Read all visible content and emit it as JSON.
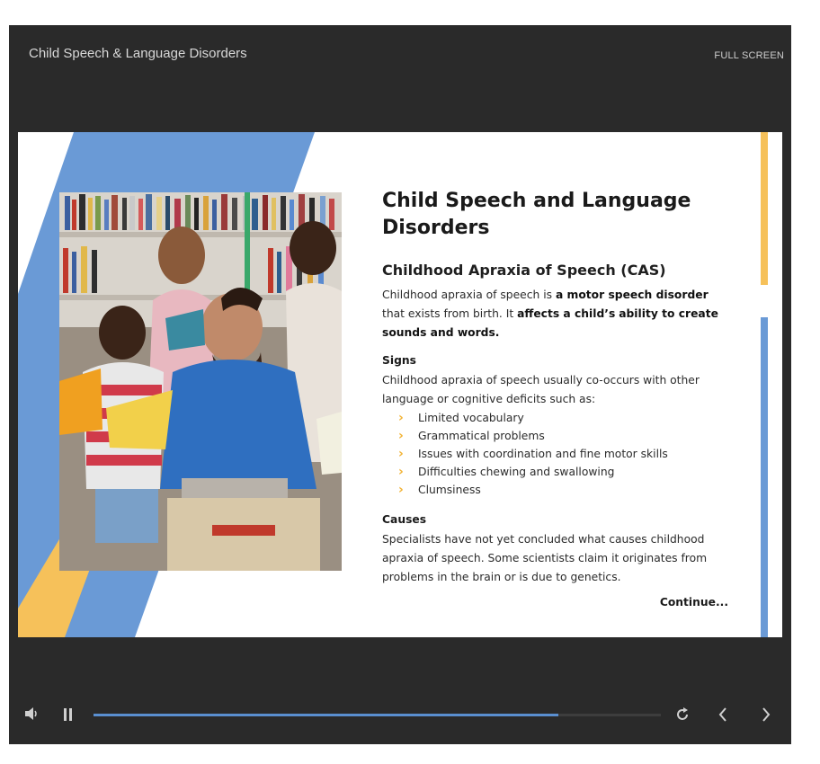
{
  "player": {
    "title": "Child Speech & Language Disorders",
    "fullscreen_label": "FULL SCREEN"
  },
  "slide": {
    "heading": "Child Speech and Language Disorders",
    "subheading": "Childhood Apraxia of Speech (CAS)",
    "intro": {
      "t1": "Childhood apraxia of speech is ",
      "b1": "a motor speech disorder",
      "t2": " that exists from birth. It ",
      "b2": "affects a child’s",
      "t3": " ",
      "b3": "ability to create sounds and words."
    },
    "signs_heading": "Signs",
    "signs_text": "Childhood apraxia of speech usually co-occurs with other language or cognitive deficits such as:",
    "signs": [
      "Limited vocabulary",
      "Grammatical problems",
      "Issues with coordination and fine motor skills",
      "Difficulties chewing and swallowing",
      "Clumsiness"
    ],
    "causes_heading": "Causes",
    "causes_text": "Specialists have not yet concluded what causes childhood apraxia of speech. Some scientists claim it originates from problems in the brain or is due to genetics.",
    "continue_label": "Continue..."
  },
  "playback": {
    "progress_fraction": 0.82,
    "icons": [
      "volume-icon",
      "pause-icon",
      "replay-icon",
      "previous-icon",
      "next-icon"
    ]
  },
  "colors": {
    "accent_blue": "#5a8fd0",
    "accent_yellow": "#f6c15a",
    "player_bg": "#2a2a2a"
  }
}
